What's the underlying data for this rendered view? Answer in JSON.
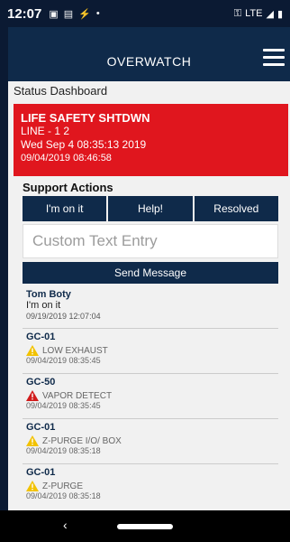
{
  "status_bar": {
    "time": "12:07",
    "network": "LTE"
  },
  "appbar": {
    "title": "OVERWATCH"
  },
  "dashboard": {
    "title": "Status Dashboard"
  },
  "alarm": {
    "title": "LIFE SAFETY SHTDWN",
    "line": "LINE - 1 2",
    "datetime": "Wed Sep 4 08:35:13 2019",
    "timestamp": "09/04/2019 08:46:58"
  },
  "support": {
    "title": "Support Actions",
    "buttons": [
      "I'm on it",
      "Help!",
      "Resolved"
    ],
    "custom_placeholder": "Custom Text Entry",
    "send_label": "Send Message"
  },
  "message": {
    "name": "Tom Boty",
    "text": "I'm on it",
    "timestamp": "09/19/2019 12:07:04"
  },
  "alarms": [
    {
      "code": "GC-01",
      "desc": "LOW EXHAUST",
      "timestamp": "09/04/2019 08:35:45",
      "icon": "warning-icon",
      "color": "#f2c200"
    },
    {
      "code": "GC-50",
      "desc": "VAPOR DETECT",
      "timestamp": "09/04/2019 08:35:45",
      "icon": "alert-icon",
      "color": "#d11b1b"
    },
    {
      "code": "GC-01",
      "desc": "Z-PURGE I/O/ BOX",
      "timestamp": "09/04/2019 08:35:18",
      "icon": "warning-icon",
      "color": "#f2c200"
    },
    {
      "code": "GC-01",
      "desc": "Z-PURGE",
      "timestamp": "09/04/2019 08:35:18",
      "icon": "warning-icon",
      "color": "#f2c200"
    }
  ]
}
